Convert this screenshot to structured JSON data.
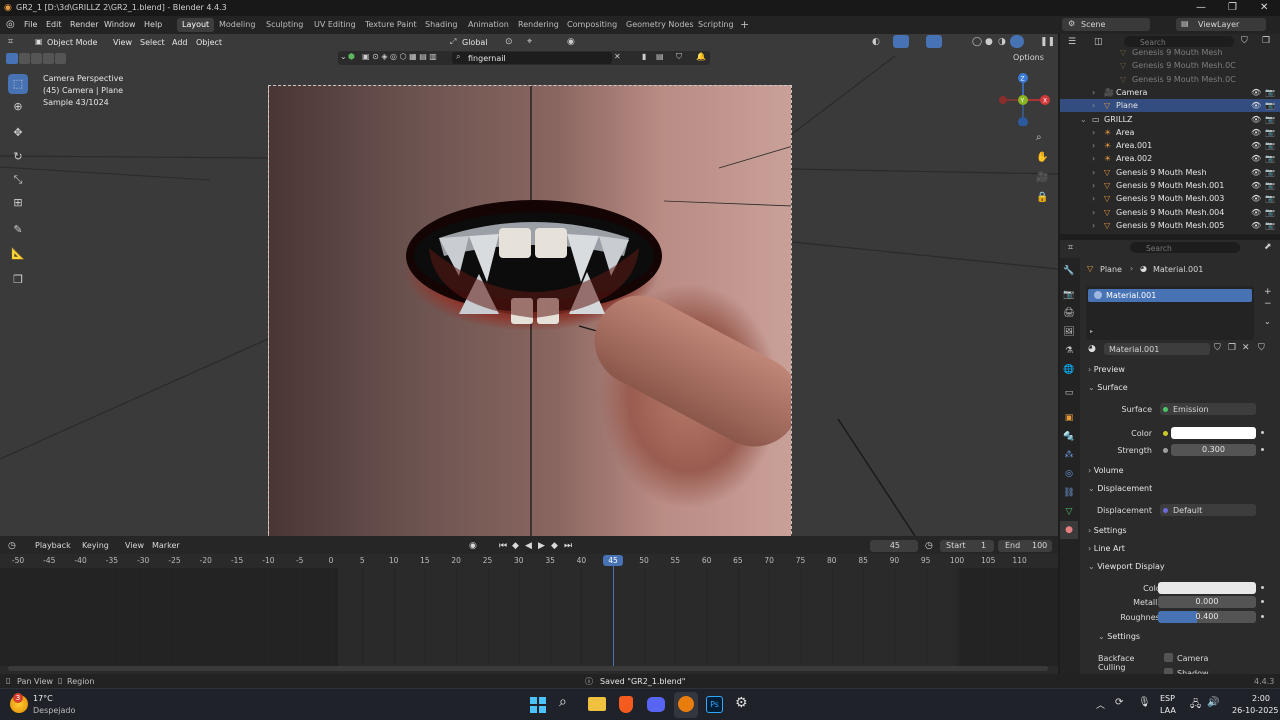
{
  "window": {
    "title": "GR2_1 [D:\\3d\\GRILLZ 2\\GR2_1.blend] - Blender 4.4.3"
  },
  "menu": [
    "File",
    "Edit",
    "Render",
    "Window",
    "Help"
  ],
  "workspaces": [
    "Layout",
    "Modeling",
    "Sculpting",
    "UV Editing",
    "Texture Paint",
    "Shading",
    "Animation",
    "Rendering",
    "Compositing",
    "Geometry Nodes",
    "Scripting"
  ],
  "scene": {
    "name": "Scene",
    "view_layer": "ViewLayer"
  },
  "viewport": {
    "mode": "Object Mode",
    "menus": [
      "View",
      "Select",
      "Add",
      "Object"
    ],
    "transform": "Global",
    "search_value": "fingernail",
    "options": "Options",
    "info": [
      "Camera Perspective",
      "(45) Camera | Plane",
      "Sample 43/1024"
    ]
  },
  "outliner": {
    "search_placeholder": "Search",
    "items": [
      {
        "label": "Genesis 9 Mouth Mesh",
        "dim": true
      },
      {
        "label": "Genesis 9 Mouth Mesh.0C",
        "dim": true
      },
      {
        "label": "Genesis 9 Mouth Mesh.0C",
        "dim": true
      },
      {
        "label": "Camera",
        "dim": false
      },
      {
        "label": "Plane",
        "dim": false,
        "selected": true
      },
      {
        "label": "GRILLZ",
        "dim": false
      },
      {
        "label": "Area",
        "dim": false
      },
      {
        "label": "Area.001",
        "dim": false
      },
      {
        "label": "Area.002",
        "dim": false
      },
      {
        "label": "Genesis 9 Mouth Mesh",
        "dim": false
      },
      {
        "label": "Genesis 9 Mouth Mesh.001",
        "dim": false
      },
      {
        "label": "Genesis 9 Mouth Mesh.003",
        "dim": false
      },
      {
        "label": "Genesis 9 Mouth Mesh.004",
        "dim": false
      },
      {
        "label": "Genesis 9 Mouth Mesh.005",
        "dim": false
      }
    ]
  },
  "properties": {
    "search_placeholder": "Search",
    "breadcrumb": [
      "Plane",
      "Material.001"
    ],
    "slot": "Material.001",
    "material_name": "Material.001",
    "panels": {
      "preview": "Preview",
      "surface": "Surface",
      "volume": "Volume",
      "displacement": "Displacement",
      "settings": "Settings",
      "line_art": "Line Art",
      "viewport_display": "Viewport Display",
      "sub_settings": "Settings"
    },
    "surface": {
      "label": "Surface",
      "value": "Emission",
      "color_label": "Color",
      "strength_label": "Strength",
      "strength": "0.300"
    },
    "displacement": {
      "label": "Displacement",
      "value": "Default"
    },
    "viewport_display": {
      "color_label": "Color",
      "metallic_label": "Metallic",
      "metallic": "0.000",
      "roughness_label": "Roughness",
      "roughness": "0.400"
    },
    "backface": {
      "label": "Backface Culling",
      "camera": "Camera",
      "shadow": "Shadow"
    }
  },
  "timeline": {
    "menus": [
      "Playback",
      "Keying",
      "View",
      "Marker"
    ],
    "current_frame": "45",
    "start_label": "Start",
    "start": "1",
    "end_label": "End",
    "end": "100",
    "ticks": [
      "-50",
      "-45",
      "-40",
      "-35",
      "-30",
      "-25",
      "-20",
      "-15",
      "-10",
      "-5",
      "0",
      "5",
      "10",
      "15",
      "20",
      "25",
      "30",
      "35",
      "40",
      "45",
      "50",
      "55",
      "60",
      "65",
      "70",
      "75",
      "80",
      "85",
      "90",
      "95",
      "100",
      "105",
      "110"
    ]
  },
  "status": {
    "left": "Pan View",
    "middle": "Region",
    "saved": "Saved \"GR2_1.blend\"",
    "version": "4.4.3"
  },
  "taskbar": {
    "temp": "17°C",
    "weather": "Despejado",
    "lang": "ESP",
    "lang2": "LAA",
    "time": "2:00",
    "date": "26-10-2025",
    "badge": "3"
  },
  "colors": {
    "accent": "#4772b3",
    "selected": "#334d80",
    "header": "#232323",
    "panel": "#2b2b2b"
  }
}
